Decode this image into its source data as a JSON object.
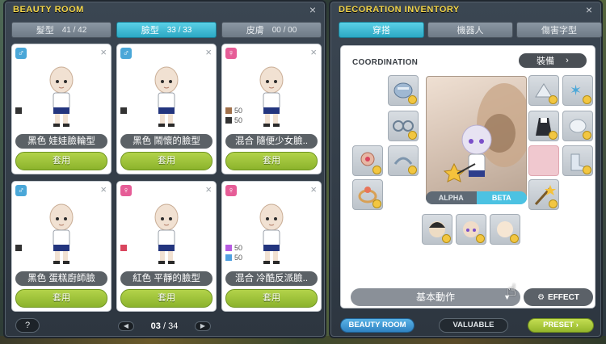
{
  "beauty_room": {
    "title": "BEAUTY ROOM",
    "tabs": [
      {
        "label": "髮型",
        "count": "41 / 42",
        "active": false
      },
      {
        "label": "臉型",
        "count": "33 / 33",
        "active": true
      },
      {
        "label": "皮膚",
        "count": "00 / 00",
        "active": false
      }
    ],
    "cards": [
      {
        "gender": "male",
        "name": "黑色 娃娃臉輪型",
        "apply": "套用",
        "swatches": [
          {
            "color": "#333333",
            "amount": ""
          }
        ]
      },
      {
        "gender": "male",
        "name": "黑色 鬧懷的臉型",
        "apply": "套用",
        "swatches": [
          {
            "color": "#333333",
            "amount": ""
          }
        ]
      },
      {
        "gender": "female",
        "name": "混合 隨便少女臉..",
        "apply": "套用",
        "swatches": [
          {
            "color": "#a0704a",
            "amount": "50"
          },
          {
            "color": "#333333",
            "amount": "50"
          }
        ]
      },
      {
        "gender": "male",
        "name": "黑色 蛋糕廚師臉",
        "apply": "套用",
        "swatches": [
          {
            "color": "#333333",
            "amount": ""
          }
        ]
      },
      {
        "gender": "female",
        "name": "紅色 平靜的臉型",
        "apply": "套用",
        "swatches": [
          {
            "color": "#d9455e",
            "amount": ""
          }
        ]
      },
      {
        "gender": "female",
        "name": "混合 冷酷反派臉..",
        "apply": "套用",
        "swatches": [
          {
            "color": "#b65be0",
            "amount": "50"
          },
          {
            "color": "#4f9fe0",
            "amount": "50"
          }
        ]
      }
    ],
    "help": "?",
    "pager": {
      "current": "03",
      "separator": " / ",
      "total": "34",
      "prev": "◀",
      "next": "▶"
    }
  },
  "decoration": {
    "title": "DECORATION INVENTORY",
    "tabs": [
      {
        "label": "穿搭",
        "active": true
      },
      {
        "label": "機器人",
        "active": false
      },
      {
        "label": "傷害字型",
        "active": false
      }
    ],
    "coordination_label": "COORDINATION",
    "equip_label": "裝備",
    "equip_arrow": "›",
    "alpha_label": "ALPHA",
    "beta_label": "BETA",
    "motion_label": "基本動作",
    "motion_chevron": "▼",
    "effect_label": "EFFECT",
    "buttons": {
      "beauty_room": "BEAUTY ROOM",
      "valuable": "VALUABLE",
      "preset": "PRESET"
    },
    "preset_arrow": "›"
  },
  "colors": {
    "title_yellow": "#f4d64a",
    "active_tab": "#2ca8c4",
    "apply_green": "#8bb32c",
    "male": "#4aa7d8",
    "female": "#e65d97"
  }
}
